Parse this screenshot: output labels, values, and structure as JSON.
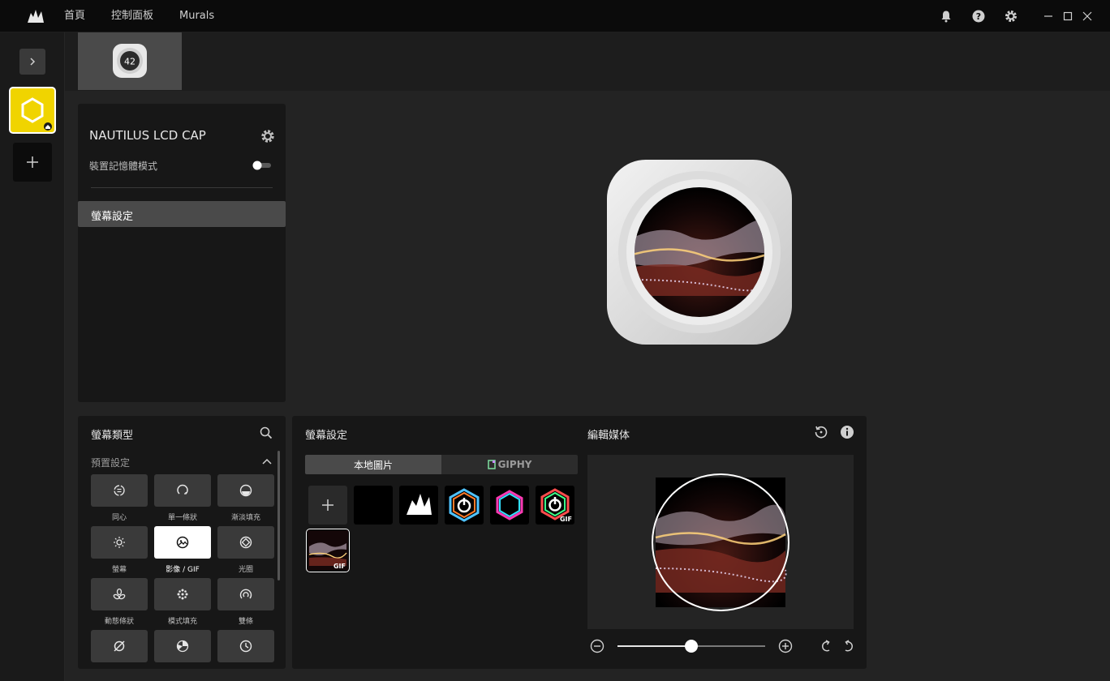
{
  "topbar": {
    "nav": [
      "首頁",
      "控制面板",
      "Murals"
    ],
    "icons": [
      "bell-icon",
      "help-icon",
      "gear-icon"
    ],
    "window_controls": [
      "minimize-icon",
      "maximize-icon",
      "close-icon"
    ]
  },
  "device_strip": {
    "tile_number": "42"
  },
  "device_panel": {
    "name": "NAUTILUS LCD CAP",
    "memory_mode_label": "裝置記憶體模式",
    "memory_mode_on": false,
    "menu_item": "螢幕設定"
  },
  "screen_type": {
    "title": "螢幕類型",
    "section": "預置設定",
    "tiles": [
      {
        "label": "同心",
        "icon": "concentric-icon"
      },
      {
        "label": "單一條狀",
        "icon": "single-bar-icon"
      },
      {
        "label": "漸淡填充",
        "icon": "fade-fill-icon"
      },
      {
        "label": "螢幕",
        "icon": "screen-icon"
      },
      {
        "label": "影像 / GIF",
        "icon": "image-gif-icon",
        "selected": true
      },
      {
        "label": "光圈",
        "icon": "aperture-icon"
      },
      {
        "label": "動態條狀",
        "icon": "dynamic-bar-icon"
      },
      {
        "label": "模式填充",
        "icon": "pattern-fill-icon"
      },
      {
        "label": "雙條",
        "icon": "dual-bar-icon"
      },
      {
        "label": "",
        "icon": "empty-icon"
      },
      {
        "label": "",
        "icon": "pie-icon"
      },
      {
        "label": "",
        "icon": "clock-icon"
      }
    ]
  },
  "screen_settings": {
    "title": "螢幕設定",
    "tab_local": "本地圖片",
    "tab_giphy": "GIPHY",
    "gif_badge": "GIF"
  },
  "edit_media": {
    "title": "編輯媒体",
    "zoom_level": 0.5
  },
  "colors": {
    "accent_yellow": "#f0d400",
    "panel_bg": "#171717",
    "selected_tile": "#ffffff"
  }
}
